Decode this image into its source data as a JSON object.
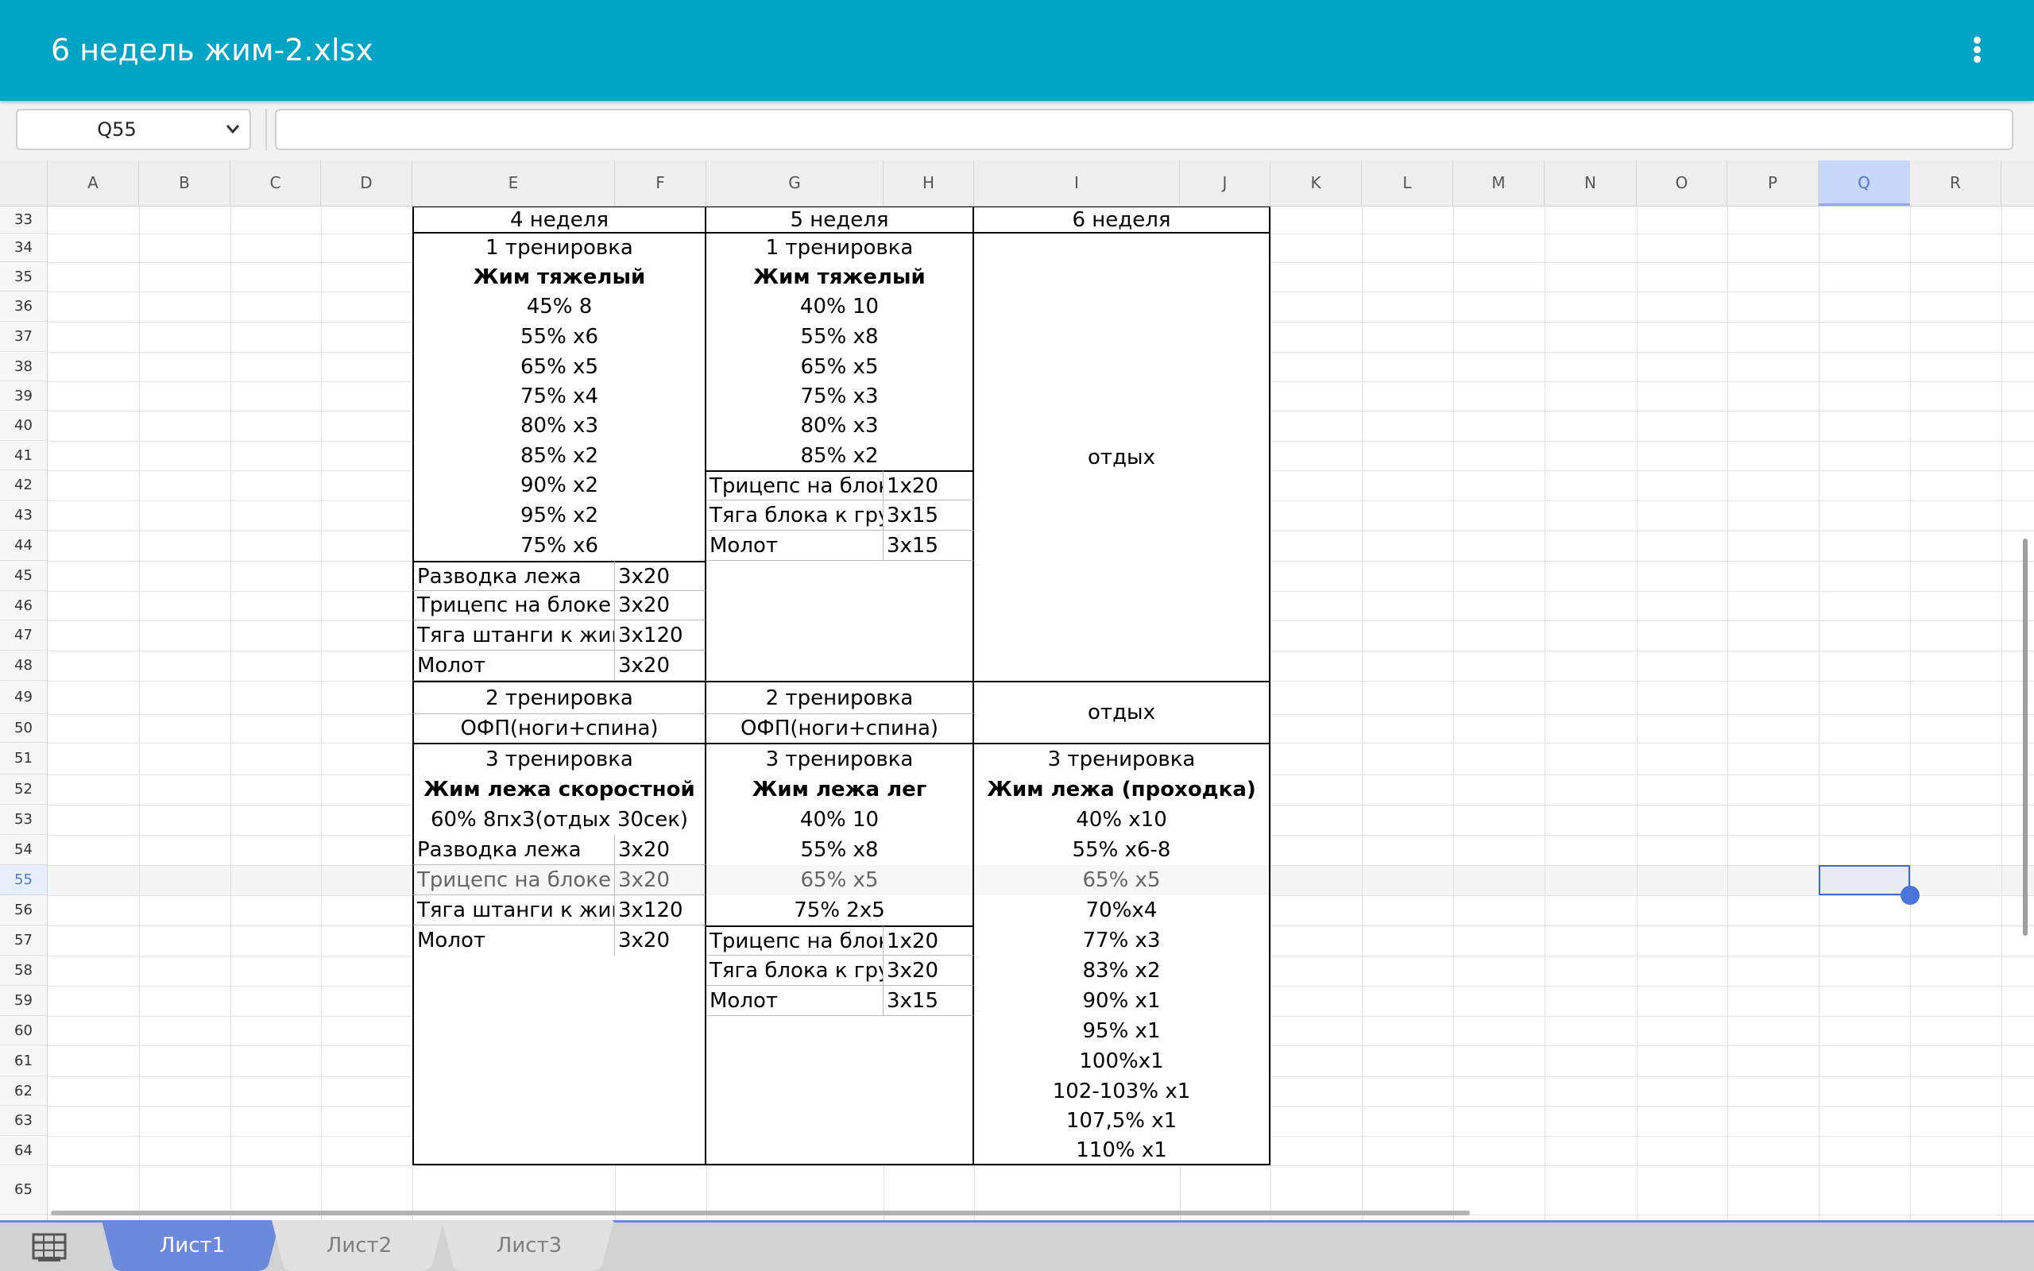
{
  "app": {
    "title": "6 недель жим-2.xlsx",
    "menu_icon": "more-vert-icon"
  },
  "formula_bar": {
    "cell_ref": "Q55",
    "formula": ""
  },
  "columns": [
    "A",
    "B",
    "C",
    "D",
    "E",
    "F",
    "G",
    "H",
    "I",
    "J",
    "K",
    "L",
    "M",
    "N",
    "O",
    "P",
    "Q",
    "R"
  ],
  "rows": [
    "33",
    "34",
    "35",
    "36",
    "37",
    "38",
    "39",
    "40",
    "41",
    "42",
    "43",
    "44",
    "45",
    "46",
    "47",
    "48",
    "49",
    "50",
    "51",
    "52",
    "53",
    "54",
    "55",
    "56",
    "57",
    "58",
    "59",
    "60",
    "61",
    "62",
    "63",
    "64",
    "65"
  ],
  "selected": {
    "column": "Q",
    "row": "55"
  },
  "sheet": {
    "week4": {
      "header": "4 неделя",
      "t1": "1 тренировка",
      "t1_ex": "Жим тяжелый",
      "t1_sets": [
        "45% 8",
        "55% x6",
        "65% x5",
        "75% x4",
        "80% x3",
        "85% x2",
        "90% x2",
        "95% x2",
        "75% x6"
      ],
      "t1_acc": [
        {
          "name": "Разводка лежа",
          "sets": "3x20"
        },
        {
          "name": "Трицепс на блоке",
          "sets": "3x20"
        },
        {
          "name": "Тяга штанги к жив",
          "sets": "3x120"
        },
        {
          "name": "Молот",
          "sets": "3x20"
        }
      ],
      "t2": "2 тренировка",
      "t2_ex": "ОФП(ноги+спина)",
      "t3": "3 тренировка",
      "t3_ex": "Жим лежа скоростной",
      "t3_sets": [
        "60% 8пх3(отдых 30сек)"
      ],
      "t3_acc": [
        {
          "name": "Разводка лежа",
          "sets": "3x20"
        },
        {
          "name": "Трицепс на блоке",
          "sets": "3x20"
        },
        {
          "name": "Тяга штанги к жив",
          "sets": "3x120"
        },
        {
          "name": "Молот",
          "sets": "3x20"
        }
      ]
    },
    "week5": {
      "header": "5 неделя",
      "t1": "1 тренировка",
      "t1_ex": "Жим тяжелый",
      "t1_sets": [
        "40% 10",
        "55% x8",
        "65% x5",
        "75% x3",
        "80% x3",
        "85% x2"
      ],
      "t1_acc": [
        {
          "name": "Трицепс на блок",
          "sets": "1x20"
        },
        {
          "name": "Тяга блока к гру",
          "sets": "3x15"
        },
        {
          "name": "Молот",
          "sets": "3x15"
        }
      ],
      "t2": "2 тренировка",
      "t2_ex": "ОФП(ноги+спина)",
      "t3": "3 тренировка",
      "t3_ex": "Жим лежа лег",
      "t3_sets": [
        "40% 10",
        "55% x8",
        "65% x5",
        "75% 2x5"
      ],
      "t3_acc": [
        {
          "name": "Трицепс на блок",
          "sets": "1x20"
        },
        {
          "name": "Тяга блока к гру",
          "sets": "3x20"
        },
        {
          "name": "Молот",
          "sets": "3x15"
        }
      ]
    },
    "week6": {
      "header": "6 неделя",
      "t1_rest": "отдых",
      "t2_rest": "отдых",
      "t3": "3 тренировка",
      "t3_ex": "Жим лежа (проходка)",
      "t3_sets": [
        "40% x10",
        "55% x6-8",
        "65% x5",
        "70%x4",
        "77% x3",
        "83% x2",
        "90% x1",
        "95% x1",
        "100%x1",
        "102-103% x1",
        "107,5% x1",
        "110% x1"
      ]
    }
  },
  "tabs": [
    {
      "label": "Лист1",
      "active": true
    },
    {
      "label": "Лист2",
      "active": false
    },
    {
      "label": "Лист3",
      "active": false
    }
  ],
  "icons": {
    "name_box": "chevron-down-icon",
    "sheets": "grid-icon"
  },
  "colors": {
    "appbar": "#00a5c6",
    "accent": "#4a74da",
    "active_tab": "#6b89dd"
  }
}
